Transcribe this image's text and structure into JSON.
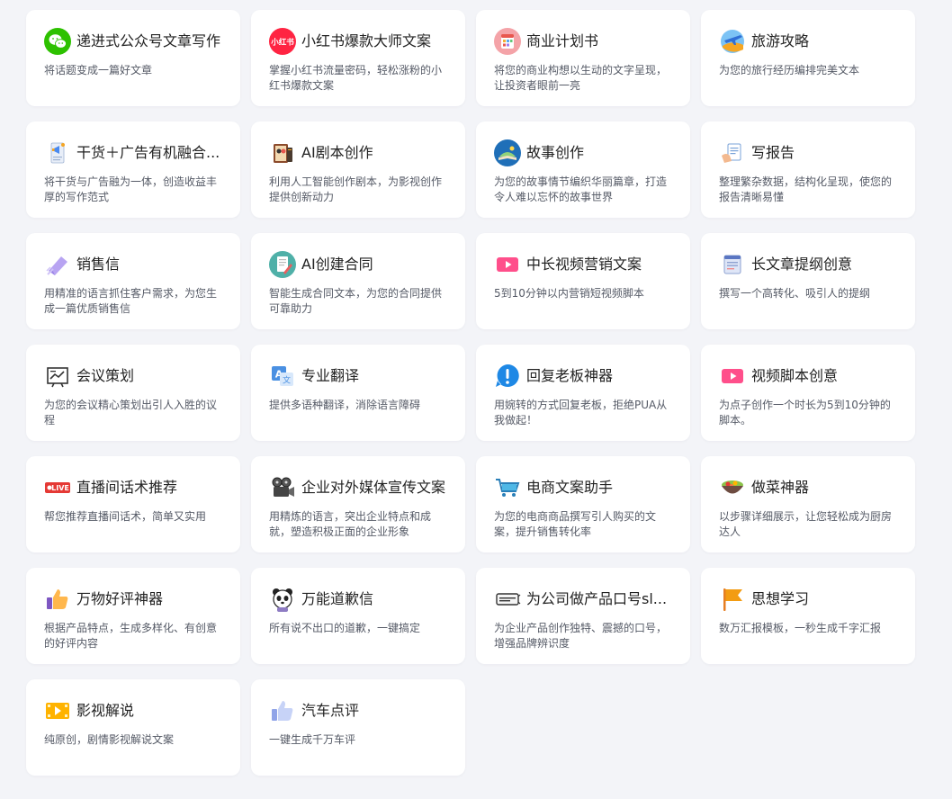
{
  "cards": [
    {
      "title": "递进式公众号文章写作",
      "desc": "将话题变成一篇好文章",
      "icon": "wechat-icon"
    },
    {
      "title": "小红书爆款大师文案",
      "desc": "掌握小红书流量密码，轻松涨粉的小红书爆款文案",
      "icon": "xiaohongshu-icon",
      "icon_text": "小红书"
    },
    {
      "title": "商业计划书",
      "desc": "将您的商业构想以生动的文字呈现，让投资者眼前一亮",
      "icon": "calendar-icon"
    },
    {
      "title": "旅游攻略",
      "desc": "为您的旅行经历编排完美文本",
      "icon": "airplane-icon"
    },
    {
      "title": "干货＋广告有机融合...",
      "desc": "将干货与广告融为一体，创造收益丰厚的写作范式",
      "icon": "megaphone-document-icon"
    },
    {
      "title": "AI剧本创作",
      "desc": "利用人工智能创作剧本，为影视创作提供创新动力",
      "icon": "script-book-icon"
    },
    {
      "title": "故事创作",
      "desc": "为您的故事情节编织华丽篇章，打造令人难以忘怀的故事世界",
      "icon": "storybook-icon"
    },
    {
      "title": "写报告",
      "desc": "整理繁杂数据，结构化呈现，使您的报告清晰易懂",
      "icon": "report-hand-icon"
    },
    {
      "title": "销售信",
      "desc": "用精准的语言抓住客户需求，为您生成一篇优质销售信",
      "icon": "sales-letter-icon"
    },
    {
      "title": "AI创建合同",
      "desc": "智能生成合同文本，为您的合同提供可靠助力",
      "icon": "contract-icon"
    },
    {
      "title": "中长视频营销文案",
      "desc": "5到10分钟以内营销短视频脚本",
      "icon": "video-play-icon"
    },
    {
      "title": "长文章提纲创意",
      "desc": "撰写一个高转化、吸引人的提纲",
      "icon": "outline-document-icon"
    },
    {
      "title": "会议策划",
      "desc": "为您的会议精心策划出引人入胜的议程",
      "icon": "meeting-board-icon"
    },
    {
      "title": "专业翻译",
      "desc": "提供多语种翻译，消除语言障碍",
      "icon": "translate-icon"
    },
    {
      "title": "回复老板神器",
      "desc": "用婉转的方式回复老板，拒绝PUA从我做起！",
      "icon": "exclamation-icon"
    },
    {
      "title": "视频脚本创意",
      "desc": "为点子创作一个时长为5到10分钟的脚本。",
      "icon": "video-play-icon"
    },
    {
      "title": "直播间话术推荐",
      "desc": "帮您推荐直播间话术，简单又实用",
      "icon": "live-badge-icon",
      "icon_text": "LIVE"
    },
    {
      "title": "企业对外媒体宣传文案",
      "desc": "用精炼的语言，突出企业特点和成就，塑造积极正面的企业形象",
      "icon": "film-camera-icon"
    },
    {
      "title": "电商文案助手",
      "desc": "为您的电商商品撰写引人购买的文案，提升销售转化率",
      "icon": "shopping-cart-icon"
    },
    {
      "title": "做菜神器",
      "desc": "以步骤详细展示，让您轻松成为厨房达人",
      "icon": "food-bowl-icon"
    },
    {
      "title": "万物好评神器",
      "desc": "根据产品特点，生成多样化、有创意的好评内容",
      "icon": "thumbs-up-icon"
    },
    {
      "title": "万能道歉信",
      "desc": "所有说不出口的道歉，一键搞定",
      "icon": "panda-icon"
    },
    {
      "title": "为公司做产品口号sl...",
      "desc": "为企业产品创作独特、震撼的口号，增强品牌辨识度",
      "icon": "slogan-banner-icon"
    },
    {
      "title": "思想学习",
      "desc": "数万汇报模板，一秒生成千字汇报",
      "icon": "flag-icon"
    },
    {
      "title": "影视解说",
      "desc": "纯原创，剧情影视解说文案",
      "icon": "film-play-icon"
    },
    {
      "title": "汽车点评",
      "desc": "一键生成千万车评",
      "icon": "thumbs-up-blue-icon"
    }
  ]
}
